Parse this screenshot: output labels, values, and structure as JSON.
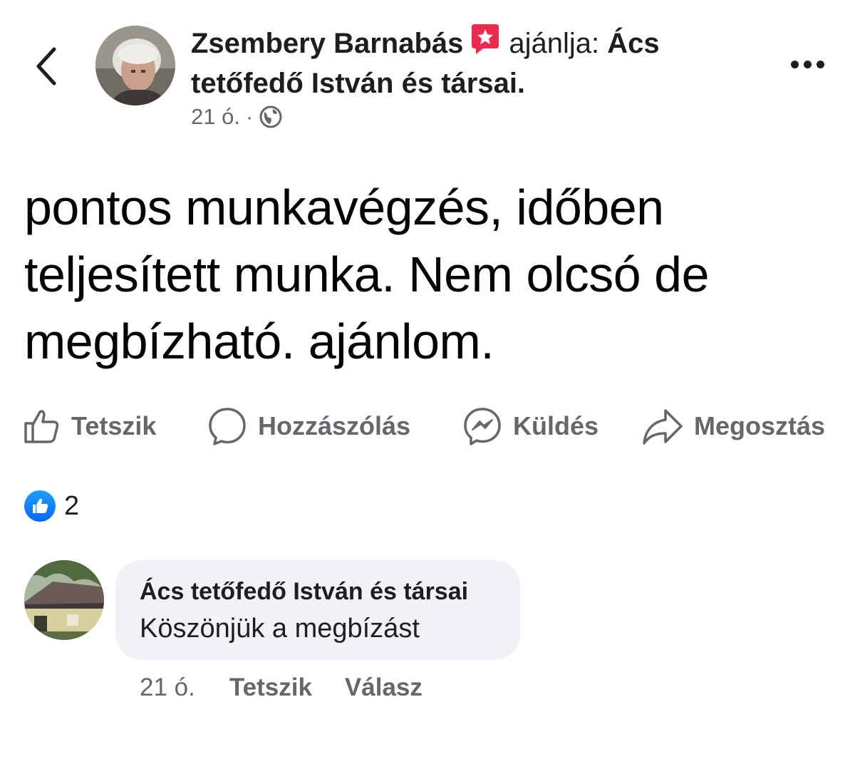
{
  "header": {
    "back_icon": "chevron-left-icon",
    "author_name": "Zsembery Barnabás",
    "badge_icon": "recommendation-star-icon",
    "recommends_text": "ajánlja:",
    "page_name": "Ács tetőfedő István és társai.",
    "time": "21 ó.",
    "separator": "·",
    "audience_icon": "globe-icon",
    "more_icon": "more-horizontal-icon"
  },
  "post": {
    "text": "pontos munkavégzés, időben teljesített munka. Nem olcsó de megbízható. ajánlom."
  },
  "actions": [
    {
      "label": "Tetszik",
      "icon": "thumbs-up-icon"
    },
    {
      "label": "Hozzászólás",
      "icon": "comment-bubble-icon"
    },
    {
      "label": "Küldés",
      "icon": "messenger-icon"
    },
    {
      "label": "Megosztás",
      "icon": "share-arrow-icon"
    }
  ],
  "reactions": {
    "icon": "like-reaction-icon",
    "count": "2",
    "color": "#0866ff"
  },
  "comment": {
    "author": "Ács tetőfedő István és társai",
    "text": "Köszönjük a megbízást",
    "time": "21 ó.",
    "like_label": "Tetszik",
    "reply_label": "Válasz"
  },
  "colors": {
    "primary_text": "#050505",
    "secondary_text": "#65676b",
    "bubble_bg": "#f0f2f5",
    "badge_pink": "#f02849"
  }
}
